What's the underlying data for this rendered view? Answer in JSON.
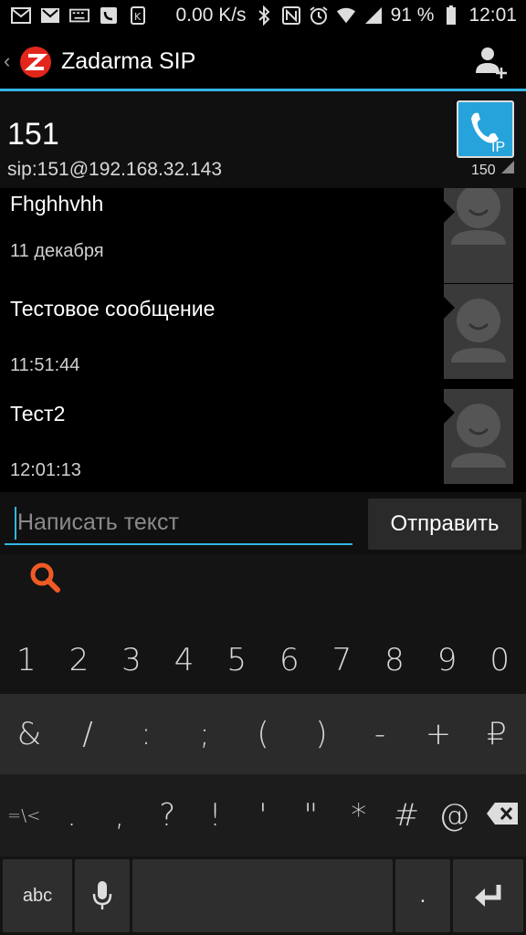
{
  "status_bar": {
    "icons_left": [
      "mail-icon",
      "gmail-icon",
      "keyboard-icon",
      "sms-icon",
      "sim-icon"
    ],
    "net_speed": "0.00 K/s",
    "icons_right": [
      "bluetooth-icon",
      "nfc-icon",
      "alarm-icon",
      "wifi-icon",
      "signal-icon"
    ],
    "battery": "91 %",
    "time": "12:01"
  },
  "action_bar": {
    "back_glyph": "‹",
    "title": "Zadarma SIP",
    "accent_color": "#33b5e5",
    "logo_color": "#e3261b"
  },
  "contact": {
    "name": "151",
    "sip": "sip:151@192.168.32.143",
    "ip_label": "IP",
    "ip_count": "150"
  },
  "messages": [
    {
      "text": "Fhghhvhh",
      "time": "11 декабря"
    },
    {
      "text": "Тестовое сообщение",
      "time": "11:51:44"
    },
    {
      "text": "Тест2",
      "time": "12:01:13"
    }
  ],
  "compose": {
    "placeholder": "Написать текст",
    "send_label": "Отправить"
  },
  "keyboard": {
    "row1": [
      "1",
      "2",
      "3",
      "4",
      "5",
      "6",
      "7",
      "8",
      "9",
      "0"
    ],
    "row2": [
      "&",
      "/",
      ":",
      ";",
      "(",
      ")",
      "-",
      "+",
      "₽"
    ],
    "row3": [
      "=\\<",
      ".",
      ",",
      "?",
      "!",
      "'",
      "\"",
      "*",
      "#",
      "@"
    ],
    "abc": "abc",
    "dot": "."
  }
}
